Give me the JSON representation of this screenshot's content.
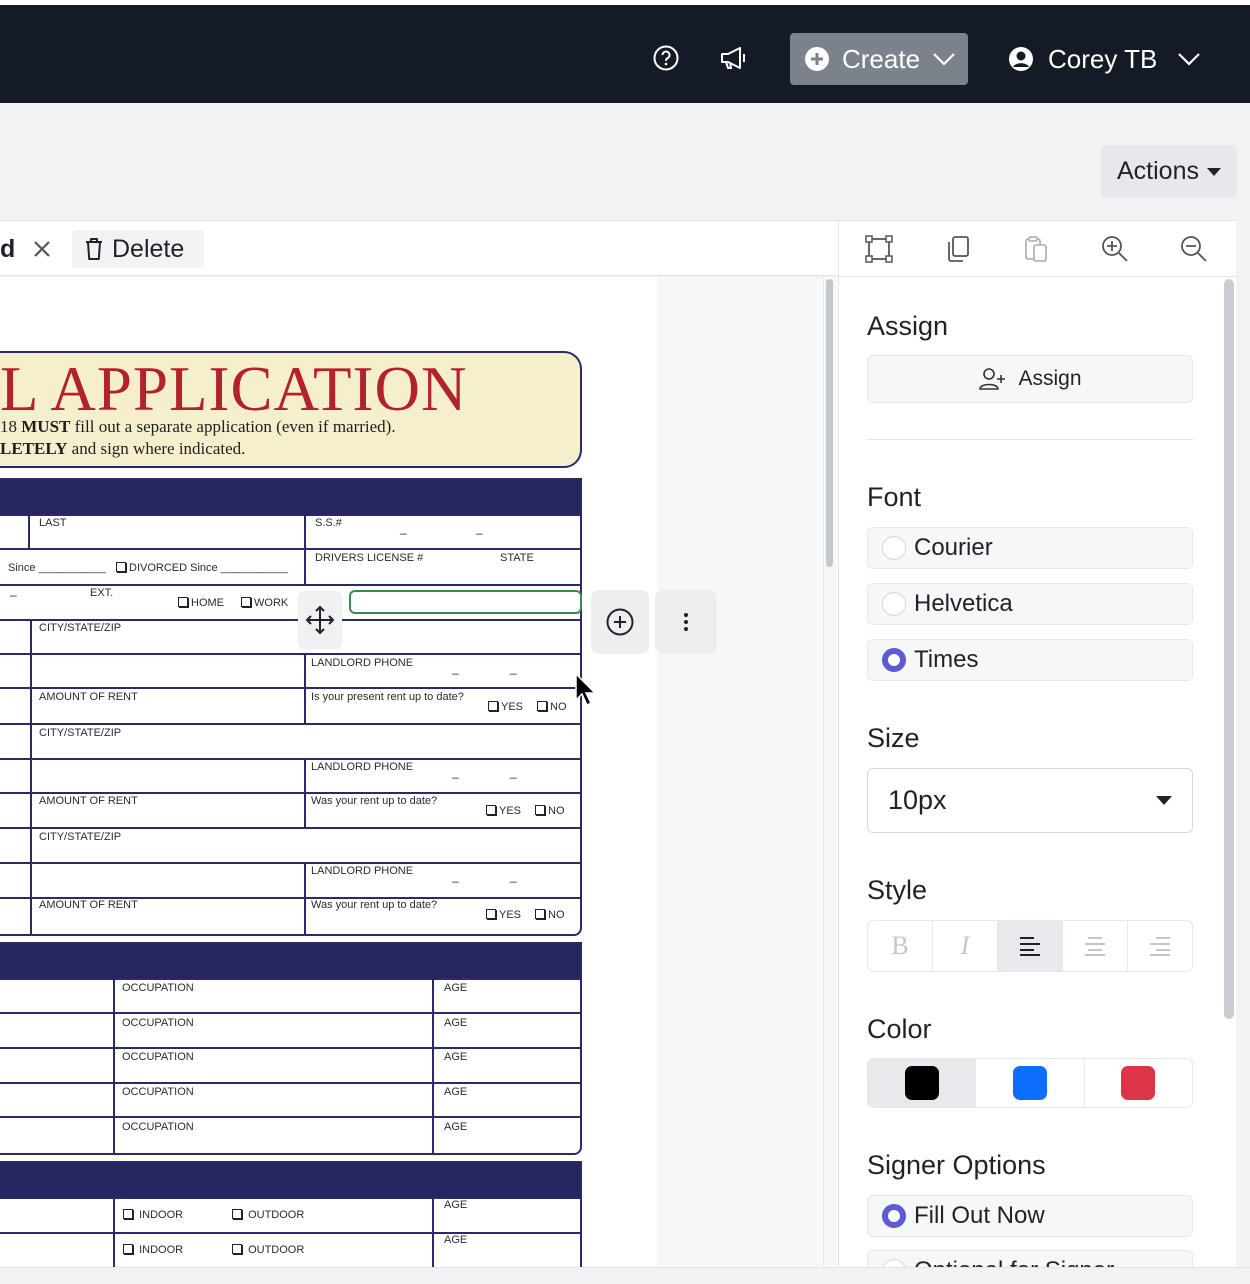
{
  "header": {
    "create_label": "Create",
    "user_name": "Corey TB",
    "icons": [
      "help-icon",
      "megaphone-icon",
      "plus-circle-icon",
      "user-circle-icon",
      "chevron-down-icon"
    ]
  },
  "actions_label": "Actions",
  "toolbar": {
    "partial_label": "d",
    "delete_label": "Delete"
  },
  "document": {
    "title": "L APPLICATION",
    "line1_pre": "18 ",
    "line1_bold": "MUST",
    "line1_post": " fill out a separate application (even if married).",
    "line2_bold": "LETELY",
    "line2_post": " and sign where indicated.",
    "labels": {
      "last": "LAST",
      "ss": "S.S.#",
      "since1": "Since ___________",
      "divorced": "DIVORCED  Since ___________",
      "drivers_license": "DRIVERS LICENSE #",
      "state": "STATE",
      "ext": "EXT.",
      "home": "HOME",
      "work": "WORK",
      "city_state_zip": "CITY/STATE/ZIP",
      "landlord_phone": "LANDLORD PHONE",
      "amount_of_rent": "AMOUNT OF RENT",
      "present_rent": "Is your present rent up to date?",
      "was_rent": "Was your rent up to date?",
      "yes": "YES",
      "no": "NO",
      "occupation": "OCCUPATION",
      "age": "AGE",
      "indoor": "INDOOR",
      "outdoor": "OUTDOOR"
    }
  },
  "panel": {
    "assign_title": "Assign",
    "assign_button": "Assign",
    "font_title": "Font",
    "fonts": [
      {
        "label": "Courier",
        "selected": false
      },
      {
        "label": "Helvetica",
        "selected": false
      },
      {
        "label": "Times",
        "selected": true
      }
    ],
    "size_title": "Size",
    "size_value": "10px",
    "style_title": "Style",
    "style_buttons": [
      "B",
      "I"
    ],
    "color_title": "Color",
    "colors": [
      "#000000",
      "#0d6efd",
      "#dc3545"
    ],
    "signer_title": "Signer Options",
    "signer_options": [
      {
        "label": "Fill Out Now",
        "selected": true
      },
      {
        "label": "Optional for Signer",
        "selected": false
      }
    ]
  }
}
